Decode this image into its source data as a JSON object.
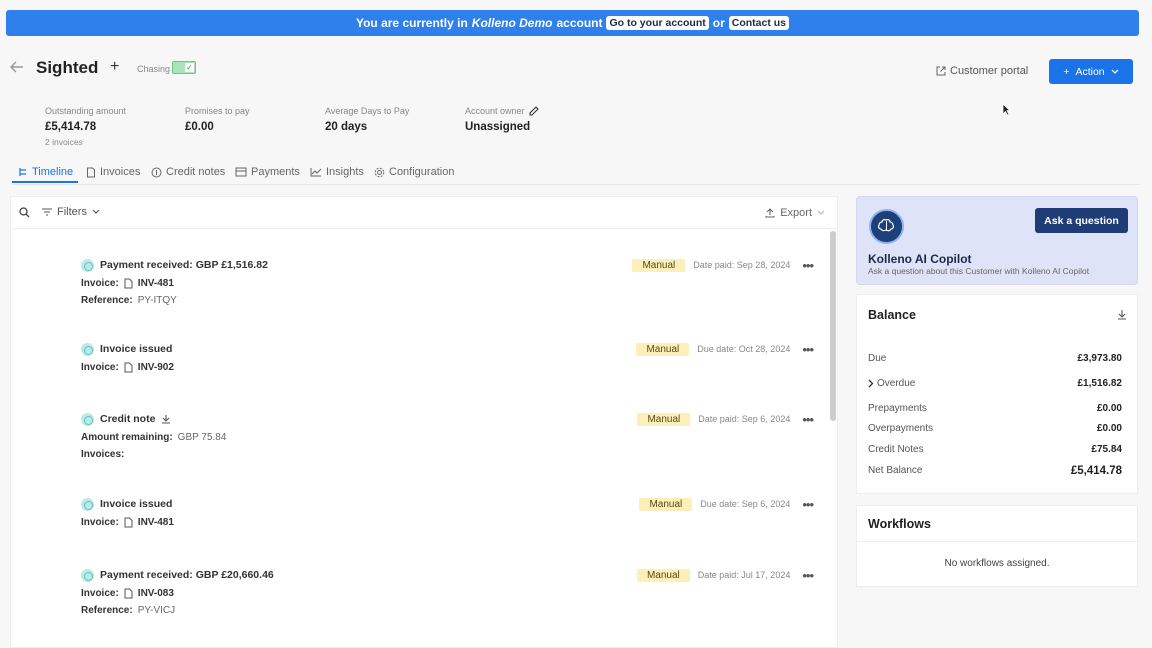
{
  "banner": {
    "pre": "You are currently in",
    "account": "Kolleno Demo",
    "mid": "account",
    "go_label": "Go to your account",
    "or": "or",
    "contact_label": "Contact us"
  },
  "header": {
    "title": "Sighted",
    "plus": "+",
    "chasing_label": "Chasing",
    "customer_portal": "Customer portal",
    "action_label": "Action"
  },
  "stats": {
    "outstanding_label": "Outstanding amount",
    "outstanding_value": "£5,414.78",
    "outstanding_sub": "2 invoices",
    "promises_label": "Promises to pay",
    "promises_value": "£0.00",
    "avg_label": "Average Days to Pay",
    "avg_value": "20 days",
    "owner_label": "Account owner",
    "owner_value": "Unassigned"
  },
  "tabs": [
    {
      "label": "Timeline",
      "icon": "timeline-icon"
    },
    {
      "label": "Invoices",
      "icon": "invoice-icon"
    },
    {
      "label": "Credit notes",
      "icon": "credit-note-icon"
    },
    {
      "label": "Payments",
      "icon": "payments-icon"
    },
    {
      "label": "Insights",
      "icon": "insights-icon"
    },
    {
      "label": "Configuration",
      "icon": "gear-icon"
    }
  ],
  "toolbar": {
    "filters_label": "Filters",
    "export_label": "Export"
  },
  "events": [
    {
      "title": "Payment received: GBP £1,516.82",
      "badge": "Manual",
      "date": "Date paid: Sep 28, 2024",
      "rows": [
        {
          "k": "Invoice:",
          "inv": "INV-481"
        },
        {
          "k": "Reference:",
          "v": "PY-ITQY"
        }
      ]
    },
    {
      "title": "Invoice issued",
      "badge": "Manual",
      "date": "Due date: Oct 28, 2024",
      "rows": [
        {
          "k": "Invoice:",
          "inv": "INV-902"
        }
      ]
    },
    {
      "title": "Credit note",
      "badge": "Manual",
      "date": "Date paid: Sep 6, 2024",
      "rows": [
        {
          "k": "Amount remaining:",
          "v": "GBP 75.84"
        },
        {
          "k": "Invoices:"
        }
      ]
    },
    {
      "title": "Invoice issued",
      "badge": "Manual",
      "date": "Due date: Sep 6, 2024",
      "rows": [
        {
          "k": "Invoice:",
          "inv": "INV-481"
        }
      ]
    },
    {
      "title": "Payment received: GBP £20,660.46",
      "badge": "Manual",
      "date": "Date paid: Jul 17, 2024",
      "rows": [
        {
          "k": "Invoice:",
          "inv": "INV-083"
        },
        {
          "k": "Reference:",
          "v": "PY-VICJ"
        }
      ]
    }
  ],
  "copilot": {
    "ask_label": "Ask a question",
    "title": "Kolleno AI Copilot",
    "subtitle": "Ask a question about this Customer with Kolleno AI Copilot"
  },
  "balance": {
    "title": "Balance",
    "rows": [
      {
        "label": "Due",
        "value": "£3,973.80"
      },
      {
        "label": "Overdue",
        "value": "£1,516.82"
      },
      {
        "label": "Prepayments",
        "value": "£0.00"
      },
      {
        "label": "Overpayments",
        "value": "£0.00"
      },
      {
        "label": "Credit Notes",
        "value": "£75.84"
      },
      {
        "label": "Net Balance",
        "value": "£5,414.78"
      }
    ]
  },
  "workflows": {
    "title": "Workflows",
    "empty": "No workflows assigned."
  },
  "colors": {
    "banner": "#2f80ed",
    "primary": "#1a73e8",
    "badge": "#fcefb9",
    "copilot_bg": "#dfe3f7",
    "ask_button": "#1f3c77"
  }
}
